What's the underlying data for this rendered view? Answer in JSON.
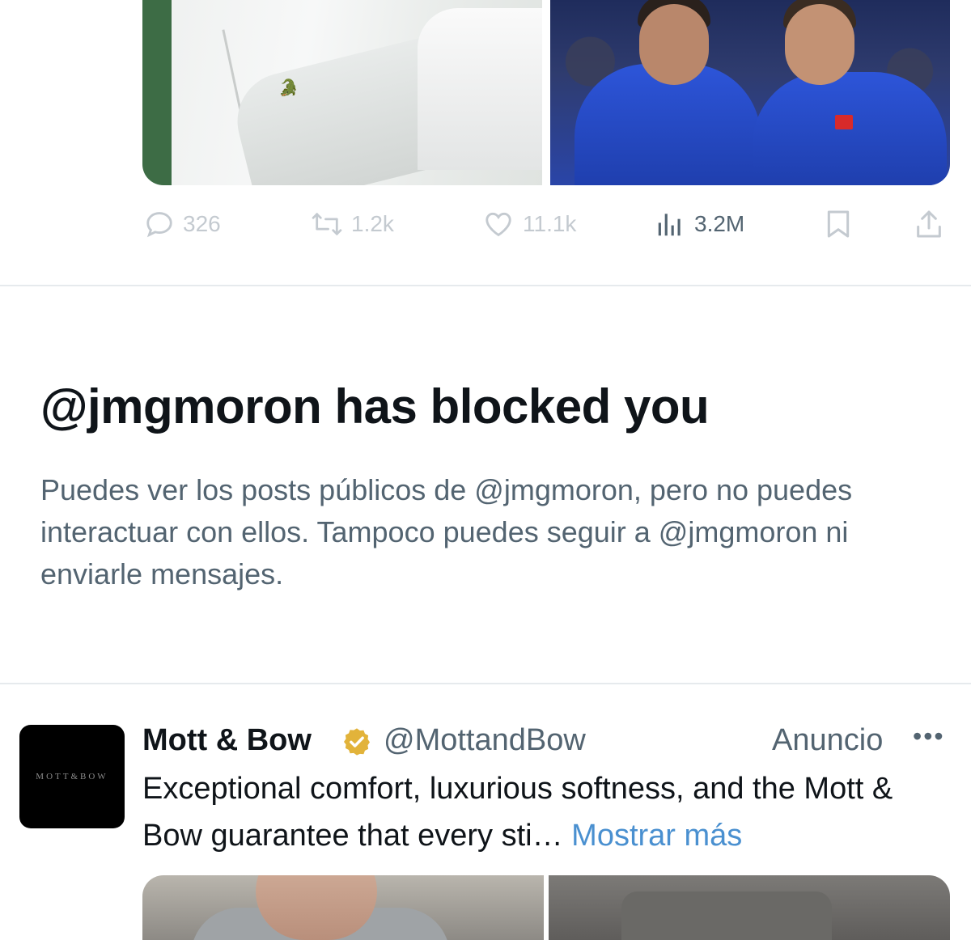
{
  "tweet_actions": {
    "replies": "326",
    "retweets": "1.2k",
    "likes": "11.1k",
    "views": "3.2M"
  },
  "blocked_notice": {
    "title": "@jmgmoron has blocked you",
    "body": "Puedes ver los posts públicos de @jmgmoron, pero no puedes interactuar con ellos. Tampoco puedes seguir a @jmgmoron ni enviarle mensajes."
  },
  "ad": {
    "avatar_text": "MOTT&BOW",
    "name": "Mott & Bow",
    "handle": "@MottandBow",
    "label": "Anuncio",
    "more": "•••",
    "text": "Exceptional comfort, luxurious softness, and the Mott & Bow guarantee that every sti… ",
    "show_more": "Mostrar más"
  },
  "colors": {
    "muted": "#536471",
    "disabled": "#c4cad0",
    "link": "#4a90d0",
    "verified_gold": "#e2b33a",
    "divider": "#e6eaed"
  },
  "icons": [
    "reply-icon",
    "retweet-icon",
    "like-icon",
    "views-icon",
    "bookmark-icon",
    "share-icon",
    "verified-icon",
    "more-icon"
  ]
}
